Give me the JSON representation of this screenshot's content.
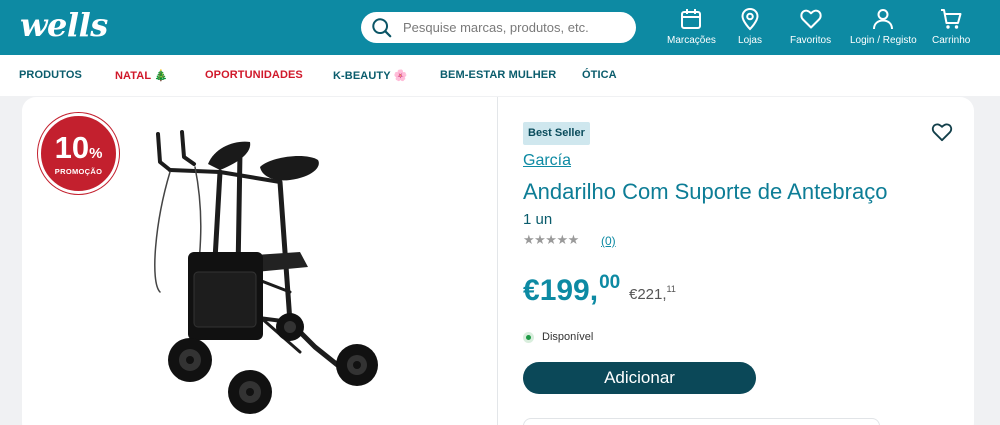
{
  "header": {
    "logo": "wells",
    "search_placeholder": "Pesquise marcas, produtos, etc.",
    "nav": [
      {
        "label": "Marcações",
        "icon": "calendar-icon"
      },
      {
        "label": "Lojas",
        "icon": "location-pin-icon"
      },
      {
        "label": "Favoritos",
        "icon": "heart-icon"
      },
      {
        "label": "Login / Registo",
        "icon": "user-icon"
      },
      {
        "label": "Carrinho",
        "icon": "cart-icon"
      }
    ]
  },
  "categories": [
    {
      "label": "PRODUTOS"
    },
    {
      "label": "NATAL 🎄"
    },
    {
      "label": "OPORTUNIDADES"
    },
    {
      "label": "K-BEAUTY 🌸"
    },
    {
      "label": "BEM-ESTAR MULHER"
    },
    {
      "label": "ÓTICA"
    }
  ],
  "promo": {
    "percent": "10",
    "symbol": "%",
    "label": "PROMOÇÃO"
  },
  "product": {
    "badge": "Best Seller",
    "brand": "García",
    "title": "Andarilho Com Suporte de Antebraço",
    "quantity": "1 un",
    "rating": "★★★★★",
    "reviews": "(0)",
    "price_currency": "€",
    "price_int": "199,",
    "price_dec": "00",
    "old_price_main": "€221,",
    "old_price_dec": "11",
    "availability": "Disponível",
    "add_button": "Adicionar"
  },
  "colors": {
    "brand_teal": "#0d8aa3",
    "dark_teal": "#0b4858",
    "promo_red": "#c3202e",
    "available_green": "#1d9a46"
  }
}
